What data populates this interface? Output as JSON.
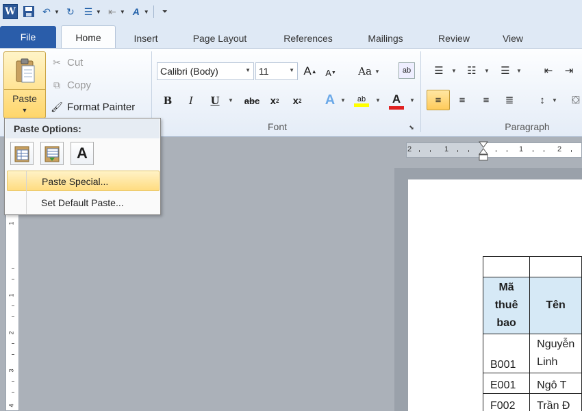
{
  "window": {
    "app_letter": "W"
  },
  "qat": {
    "icons": [
      "word-app-icon",
      "save-icon",
      "undo-icon",
      "redo-icon",
      "multilevel-list-icon",
      "decrease-indent-icon",
      "text-effects-icon",
      "customize-qat-icon"
    ]
  },
  "tabs": {
    "file": "File",
    "items": [
      "Home",
      "Insert",
      "Page Layout",
      "References",
      "Mailings",
      "Review",
      "View"
    ]
  },
  "clipboard": {
    "paste_label": "Paste",
    "cut_label": "Cut",
    "copy_label": "Copy",
    "format_painter_label": "Format Painter"
  },
  "font": {
    "group_label": "Font",
    "font_name": "Calibri (Body)",
    "font_size": "11",
    "change_case": "Aa",
    "bold": "B",
    "italic": "I",
    "underline": "U",
    "strike": "abc",
    "subscript": "x",
    "superscript": "x",
    "highlight_color": "#ffff00",
    "font_color": "#e02020"
  },
  "paragraph": {
    "group_label": "Paragraph"
  },
  "paste_menu": {
    "header": "Paste Options:",
    "paste_special": "Paste Special...",
    "set_default": "Set Default Paste...",
    "keep_text_letter": "A"
  },
  "rulers": {
    "h_nums": [
      "2",
      "1",
      "1",
      "2"
    ],
    "v_nums": [
      "1",
      "1",
      "2",
      "3",
      "4"
    ]
  },
  "table": {
    "header": [
      "Mã\nthuê\nbao",
      "Tên"
    ],
    "rows": [
      [
        "B001",
        "Nguyễn\nLinh"
      ],
      [
        "E001",
        "Ngô T"
      ],
      [
        "F002",
        "Trần Đ"
      ]
    ]
  }
}
